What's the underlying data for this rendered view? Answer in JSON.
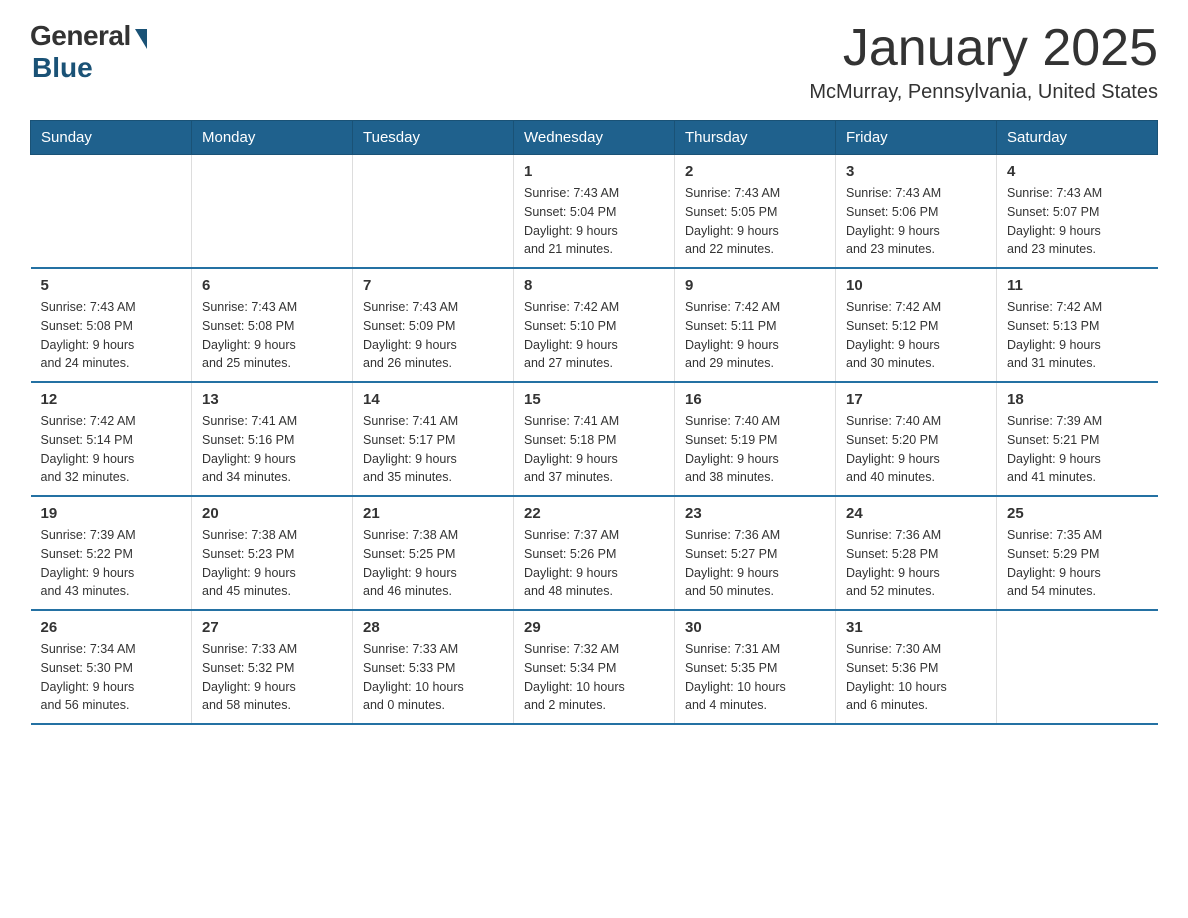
{
  "logo": {
    "general": "General",
    "blue": "Blue"
  },
  "title": "January 2025",
  "location": "McMurray, Pennsylvania, United States",
  "weekdays": [
    "Sunday",
    "Monday",
    "Tuesday",
    "Wednesday",
    "Thursday",
    "Friday",
    "Saturday"
  ],
  "weeks": [
    [
      {
        "day": "",
        "info": ""
      },
      {
        "day": "",
        "info": ""
      },
      {
        "day": "",
        "info": ""
      },
      {
        "day": "1",
        "info": "Sunrise: 7:43 AM\nSunset: 5:04 PM\nDaylight: 9 hours\nand 21 minutes."
      },
      {
        "day": "2",
        "info": "Sunrise: 7:43 AM\nSunset: 5:05 PM\nDaylight: 9 hours\nand 22 minutes."
      },
      {
        "day": "3",
        "info": "Sunrise: 7:43 AM\nSunset: 5:06 PM\nDaylight: 9 hours\nand 23 minutes."
      },
      {
        "day": "4",
        "info": "Sunrise: 7:43 AM\nSunset: 5:07 PM\nDaylight: 9 hours\nand 23 minutes."
      }
    ],
    [
      {
        "day": "5",
        "info": "Sunrise: 7:43 AM\nSunset: 5:08 PM\nDaylight: 9 hours\nand 24 minutes."
      },
      {
        "day": "6",
        "info": "Sunrise: 7:43 AM\nSunset: 5:08 PM\nDaylight: 9 hours\nand 25 minutes."
      },
      {
        "day": "7",
        "info": "Sunrise: 7:43 AM\nSunset: 5:09 PM\nDaylight: 9 hours\nand 26 minutes."
      },
      {
        "day": "8",
        "info": "Sunrise: 7:42 AM\nSunset: 5:10 PM\nDaylight: 9 hours\nand 27 minutes."
      },
      {
        "day": "9",
        "info": "Sunrise: 7:42 AM\nSunset: 5:11 PM\nDaylight: 9 hours\nand 29 minutes."
      },
      {
        "day": "10",
        "info": "Sunrise: 7:42 AM\nSunset: 5:12 PM\nDaylight: 9 hours\nand 30 minutes."
      },
      {
        "day": "11",
        "info": "Sunrise: 7:42 AM\nSunset: 5:13 PM\nDaylight: 9 hours\nand 31 minutes."
      }
    ],
    [
      {
        "day": "12",
        "info": "Sunrise: 7:42 AM\nSunset: 5:14 PM\nDaylight: 9 hours\nand 32 minutes."
      },
      {
        "day": "13",
        "info": "Sunrise: 7:41 AM\nSunset: 5:16 PM\nDaylight: 9 hours\nand 34 minutes."
      },
      {
        "day": "14",
        "info": "Sunrise: 7:41 AM\nSunset: 5:17 PM\nDaylight: 9 hours\nand 35 minutes."
      },
      {
        "day": "15",
        "info": "Sunrise: 7:41 AM\nSunset: 5:18 PM\nDaylight: 9 hours\nand 37 minutes."
      },
      {
        "day": "16",
        "info": "Sunrise: 7:40 AM\nSunset: 5:19 PM\nDaylight: 9 hours\nand 38 minutes."
      },
      {
        "day": "17",
        "info": "Sunrise: 7:40 AM\nSunset: 5:20 PM\nDaylight: 9 hours\nand 40 minutes."
      },
      {
        "day": "18",
        "info": "Sunrise: 7:39 AM\nSunset: 5:21 PM\nDaylight: 9 hours\nand 41 minutes."
      }
    ],
    [
      {
        "day": "19",
        "info": "Sunrise: 7:39 AM\nSunset: 5:22 PM\nDaylight: 9 hours\nand 43 minutes."
      },
      {
        "day": "20",
        "info": "Sunrise: 7:38 AM\nSunset: 5:23 PM\nDaylight: 9 hours\nand 45 minutes."
      },
      {
        "day": "21",
        "info": "Sunrise: 7:38 AM\nSunset: 5:25 PM\nDaylight: 9 hours\nand 46 minutes."
      },
      {
        "day": "22",
        "info": "Sunrise: 7:37 AM\nSunset: 5:26 PM\nDaylight: 9 hours\nand 48 minutes."
      },
      {
        "day": "23",
        "info": "Sunrise: 7:36 AM\nSunset: 5:27 PM\nDaylight: 9 hours\nand 50 minutes."
      },
      {
        "day": "24",
        "info": "Sunrise: 7:36 AM\nSunset: 5:28 PM\nDaylight: 9 hours\nand 52 minutes."
      },
      {
        "day": "25",
        "info": "Sunrise: 7:35 AM\nSunset: 5:29 PM\nDaylight: 9 hours\nand 54 minutes."
      }
    ],
    [
      {
        "day": "26",
        "info": "Sunrise: 7:34 AM\nSunset: 5:30 PM\nDaylight: 9 hours\nand 56 minutes."
      },
      {
        "day": "27",
        "info": "Sunrise: 7:33 AM\nSunset: 5:32 PM\nDaylight: 9 hours\nand 58 minutes."
      },
      {
        "day": "28",
        "info": "Sunrise: 7:33 AM\nSunset: 5:33 PM\nDaylight: 10 hours\nand 0 minutes."
      },
      {
        "day": "29",
        "info": "Sunrise: 7:32 AM\nSunset: 5:34 PM\nDaylight: 10 hours\nand 2 minutes."
      },
      {
        "day": "30",
        "info": "Sunrise: 7:31 AM\nSunset: 5:35 PM\nDaylight: 10 hours\nand 4 minutes."
      },
      {
        "day": "31",
        "info": "Sunrise: 7:30 AM\nSunset: 5:36 PM\nDaylight: 10 hours\nand 6 minutes."
      },
      {
        "day": "",
        "info": ""
      }
    ]
  ]
}
